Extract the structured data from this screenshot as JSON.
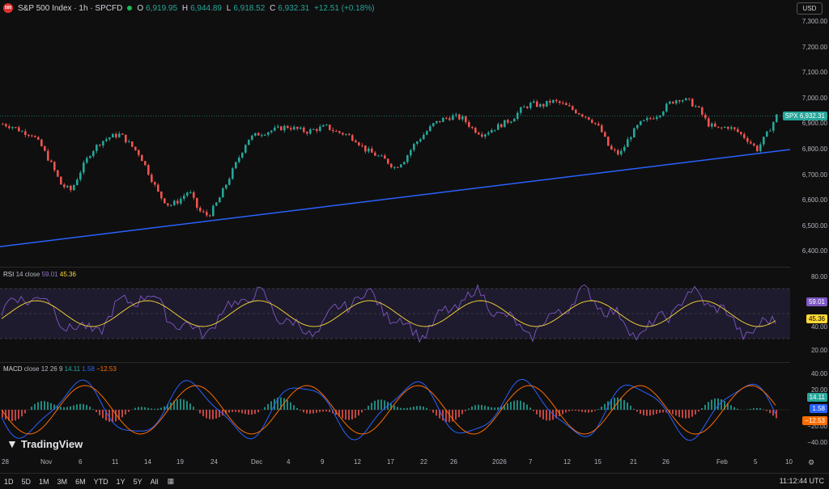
{
  "header": {
    "logo_text": "500",
    "symbol": "S&P 500 Index · 1h · SPCFD",
    "open_label": "O",
    "open": "6,919.95",
    "high_label": "H",
    "high": "6,944.89",
    "low_label": "L",
    "low": "6,918.52",
    "close_label": "C",
    "close": "6,932.31",
    "change": "+12.51 (+0.18%)"
  },
  "currency_button": "USD",
  "price_axis": [
    "7,300.00",
    "7,200.00",
    "7,100.00",
    "7,000.00",
    "6,900.00",
    "6,800.00",
    "6,700.00",
    "6,600.00",
    "6,500.00",
    "6,400.00"
  ],
  "price_tag": {
    "symbol": "SPX",
    "value": "6,932.31",
    "color": "#26a69a"
  },
  "rsi": {
    "label": "RSI",
    "params": "14 close",
    "value": "59.01",
    "ma_value": "45.36",
    "axis": [
      "80.00",
      "40.00",
      "20.00"
    ],
    "tag_value": "59.01",
    "tag_ma": "45.36",
    "color": "#7e57c2",
    "ma_color": "#fdd835"
  },
  "macd": {
    "label": "MACD",
    "params": "close 12 26 9",
    "macd": "14.11",
    "signal": "1.58",
    "hist": "−12.53",
    "axis": [
      "40.00",
      "20.00",
      "−20.00",
      "−40.00"
    ],
    "macd_color": "#2962ff",
    "signal_color": "#ff6d00",
    "hist_up": "#26a69a",
    "hist_down": "#ef5350"
  },
  "time_axis": [
    "28",
    "Nov",
    "6",
    "11",
    "14",
    "19",
    "24",
    "Dec",
    "4",
    "9",
    "12",
    "17",
    "22",
    "26",
    "2026",
    "7",
    "12",
    "15",
    "21",
    "26",
    "Feb",
    "5",
    "10"
  ],
  "timeframes": [
    "1D",
    "5D",
    "1M",
    "3M",
    "6M",
    "YTD",
    "1Y",
    "5Y",
    "All"
  ],
  "clock": "11:12:44 UTC",
  "brand": "TradingView",
  "chart_data": {
    "type": "candlestick",
    "symbol": "SPX",
    "ylim": [
      6380,
      7330
    ],
    "close_path": [
      6900,
      6890,
      6870,
      6860,
      6810,
      6740,
      6660,
      6640,
      6720,
      6790,
      6830,
      6850,
      6860,
      6820,
      6780,
      6700,
      6620,
      6580,
      6600,
      6640,
      6560,
      6540,
      6600,
      6680,
      6760,
      6840,
      6860,
      6870,
      6880,
      6890,
      6880,
      6870,
      6880,
      6890,
      6870,
      6860,
      6840,
      6800,
      6780,
      6760,
      6730,
      6760,
      6820,
      6860,
      6900,
      6920,
      6930,
      6920,
      6880,
      6860,
      6880,
      6900,
      6920,
      6960,
      6980,
      6970,
      6990,
      6980,
      6960,
      6940,
      6920,
      6880,
      6800,
      6780,
      6850,
      6900,
      6920,
      6940,
      6980,
      7000,
      6990,
      6960,
      6900,
      6880,
      6890,
      6870,
      6840,
      6800,
      6860,
      6932
    ],
    "trendline_y": [
      6420,
      6800
    ]
  }
}
